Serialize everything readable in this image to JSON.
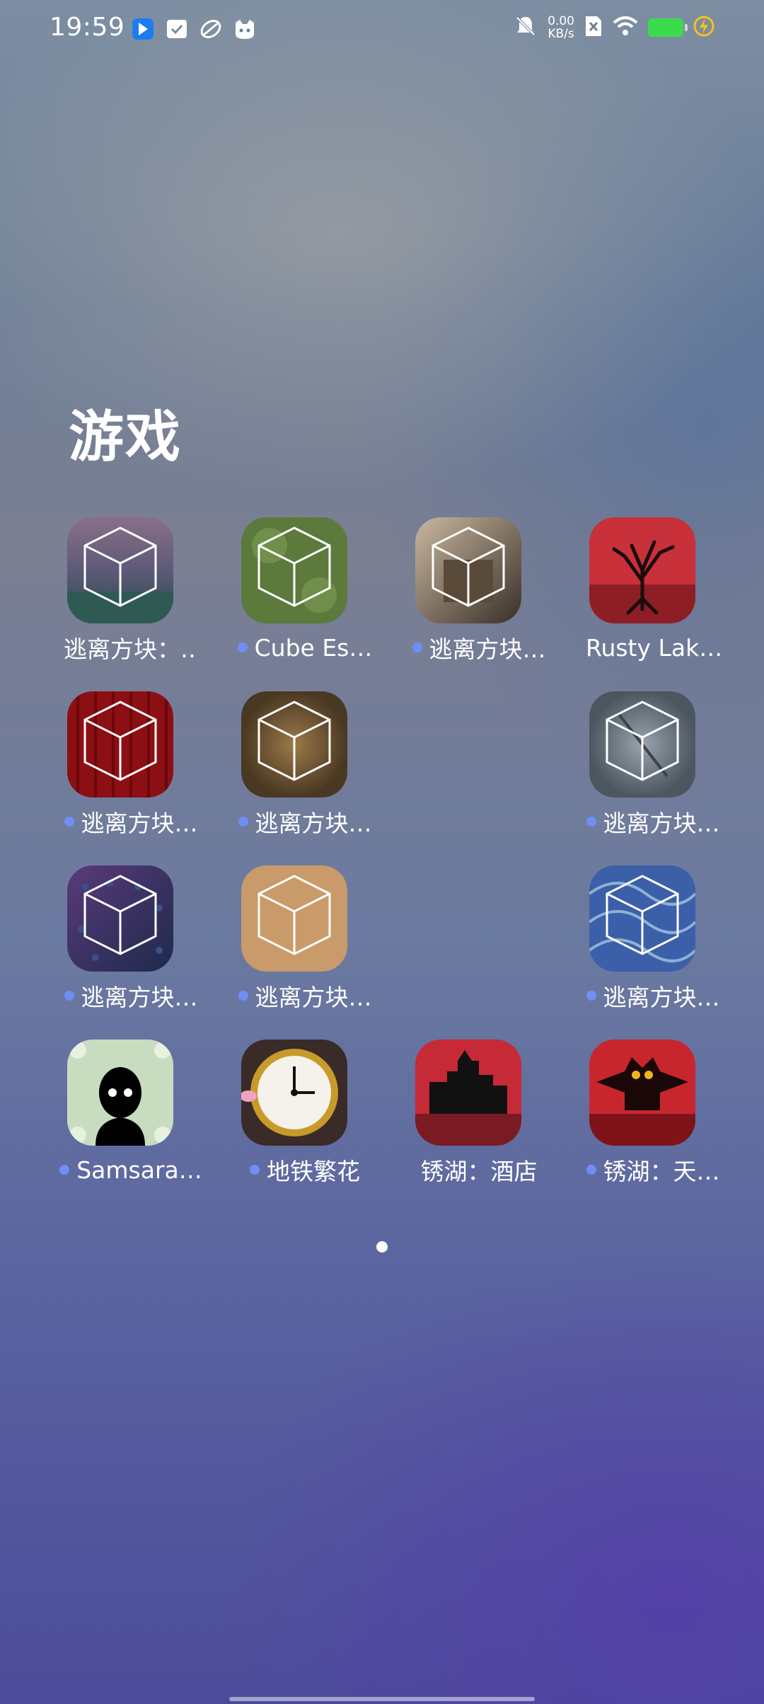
{
  "status": {
    "time": "19:59",
    "speed_value": "0.00",
    "speed_unit": "KB/s"
  },
  "folder": {
    "title": "游戏"
  },
  "apps": [
    {
      "label": "逃离方块：…",
      "dot": false,
      "theme": "cube-forest"
    },
    {
      "label": "Cube Es…",
      "dot": true,
      "theme": "cube-green"
    },
    {
      "label": "逃离方块…",
      "dot": true,
      "theme": "cube-house"
    },
    {
      "label": "Rusty Lak…",
      "dot": false,
      "theme": "tree-red"
    },
    {
      "label": "逃离方块…",
      "dot": true,
      "theme": "cube-red"
    },
    {
      "label": "逃离方块…",
      "dot": true,
      "theme": "cube-brown"
    },
    {
      "label": "逃离方块…",
      "dot": true,
      "theme": "cube-grey"
    },
    {
      "label": "逃离方块…",
      "dot": true,
      "theme": "cube-purple"
    },
    {
      "label": "逃离方块…",
      "dot": true,
      "theme": "cube-tan"
    },
    {
      "label": "逃离方块…",
      "dot": true,
      "theme": "cube-starry"
    },
    {
      "label": "Samsara…",
      "dot": true,
      "theme": "silhouette"
    },
    {
      "label": "地铁繁花",
      "dot": true,
      "theme": "clock"
    },
    {
      "label": "锈湖：酒店",
      "dot": false,
      "theme": "hotel"
    },
    {
      "label": "锈湖：天…",
      "dot": true,
      "theme": "owl"
    }
  ]
}
